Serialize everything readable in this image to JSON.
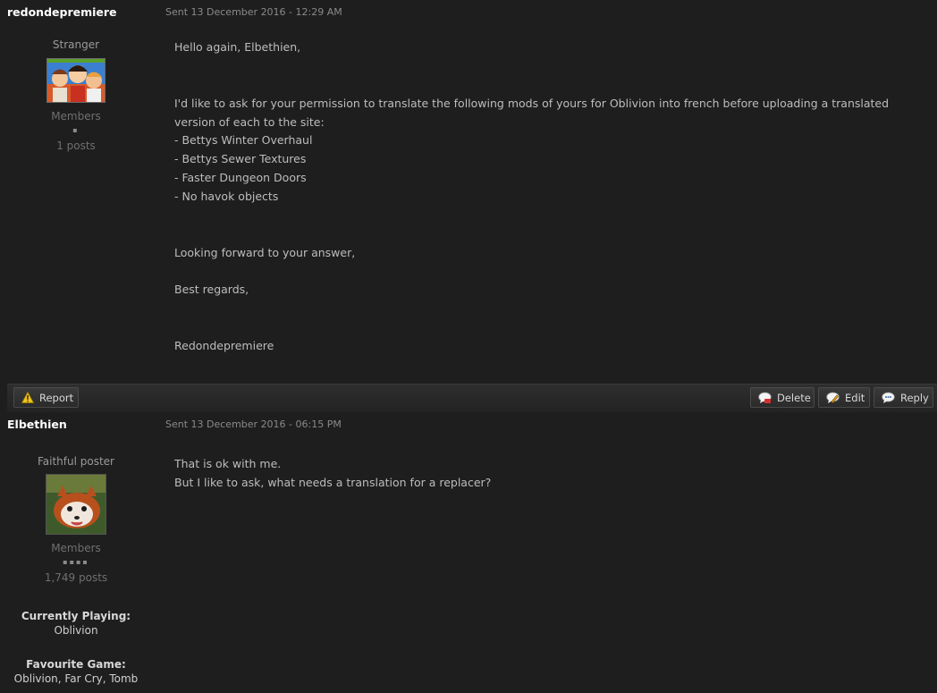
{
  "posts": [
    {
      "author": "redondepremiere",
      "sent": "Sent 13 December 2016 - 12:29 AM",
      "rank": "Stranger",
      "group": "Members",
      "pips": "▪",
      "post_count": "1 posts",
      "body": {
        "greeting": "Hello again, Elbethien,",
        "request": "I'd like to ask for your permission to translate the following mods of yours for Oblivion into french before uploading a translated version of each to the site:",
        "mods": [
          "- Bettys Winter Overhaul",
          "- Bettys Sewer Textures",
          "- Faster Dungeon Doors",
          "- No havok objects"
        ],
        "closing": "Looking forward to your answer,",
        "regards": "Best regards,",
        "signature": "Redondepremiere"
      }
    },
    {
      "author": "Elbethien",
      "sent": "Sent 13 December 2016 - 06:15 PM",
      "rank": "Faithful poster",
      "group": "Members",
      "pips": "▪▪▪▪",
      "post_count": "1,749 posts",
      "currently_playing_label": "Currently Playing:",
      "currently_playing_value": "Oblivion",
      "favourite_game_label": "Favourite Game:",
      "favourite_game_value": "Oblivion, Far Cry, Tomb",
      "body": {
        "line1": "That is ok with me.",
        "line2": "But I like to ask, what needs a translation for a replacer?"
      }
    }
  ],
  "toolbar": {
    "report": "Report",
    "delete": "Delete",
    "edit": "Edit",
    "reply": "Reply"
  },
  "icons": {
    "report": "warning-icon",
    "delete": "delete-bubble-icon",
    "edit": "edit-bubble-icon",
    "reply": "reply-bubble-icon"
  }
}
